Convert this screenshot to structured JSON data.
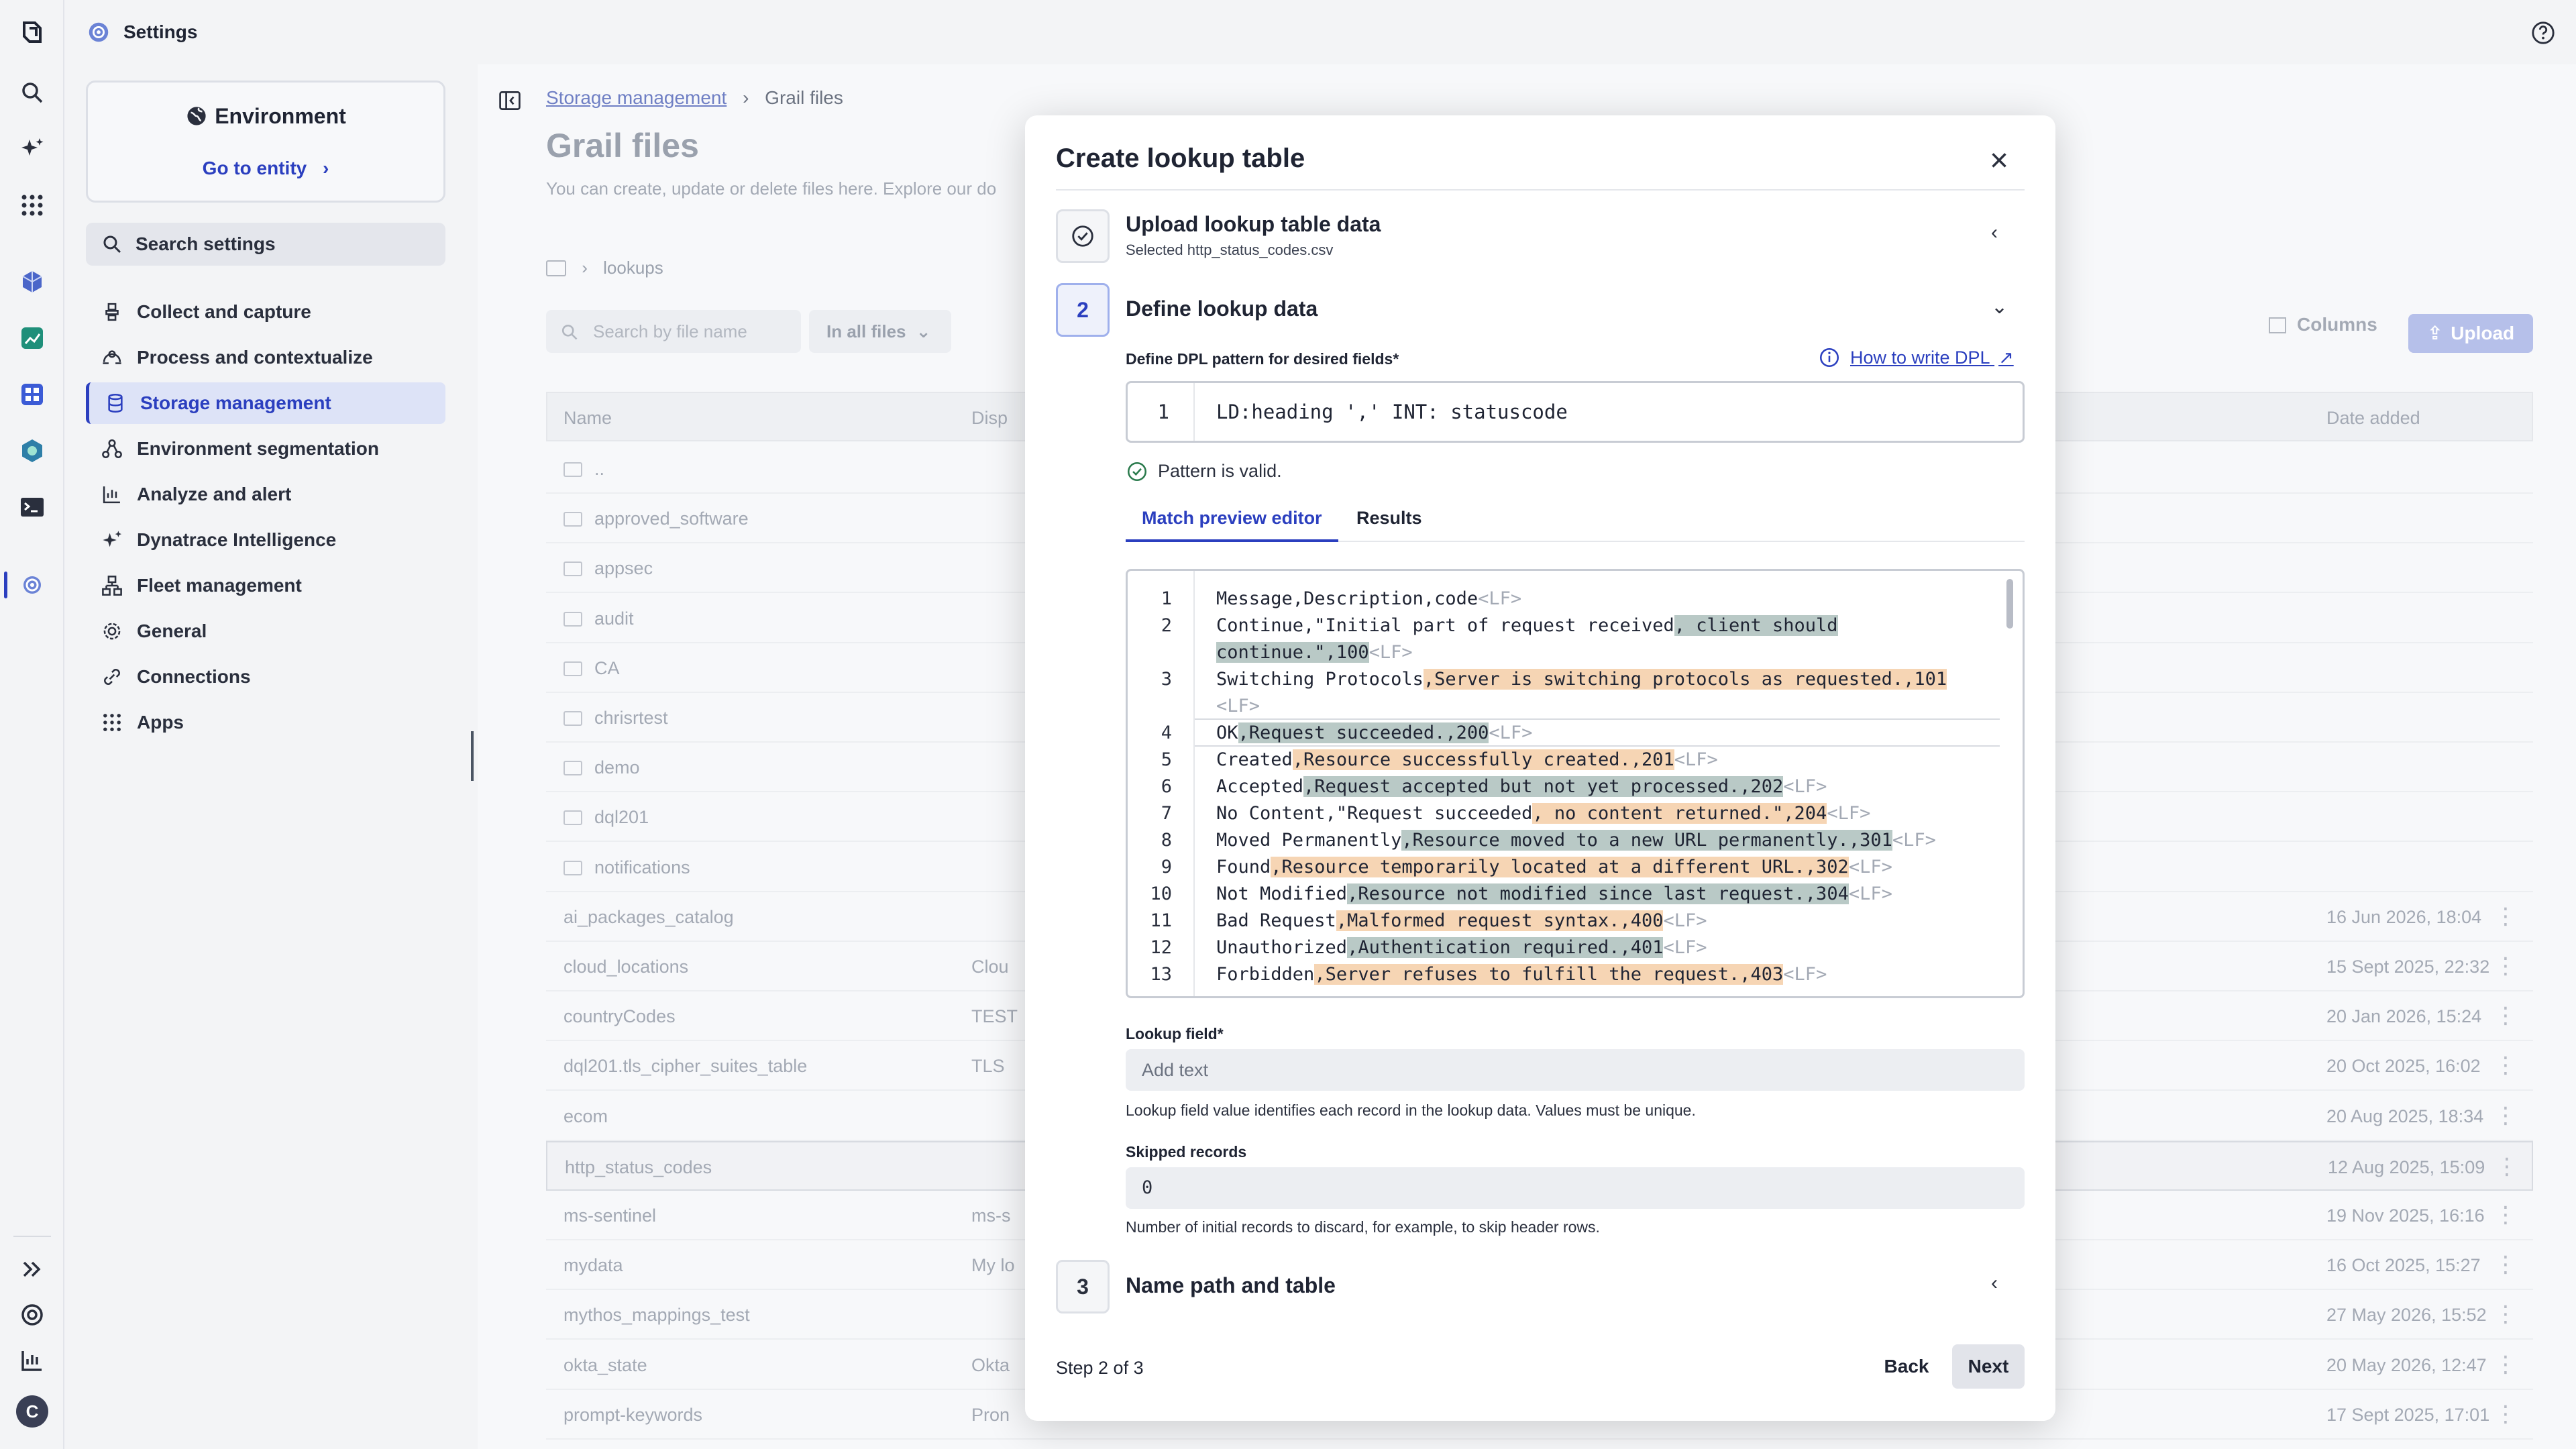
{
  "app": {
    "title": "Settings"
  },
  "sidebar": {
    "env_title": "Environment",
    "goto_label": "Go to entity",
    "search_label": "Search settings",
    "items": [
      {
        "label": "Collect and capture",
        "icon": "collect-icon"
      },
      {
        "label": "Process and contextualize",
        "icon": "process-icon"
      },
      {
        "label": "Storage management",
        "icon": "database-icon",
        "active": true
      },
      {
        "label": "Environment segmentation",
        "icon": "segmentation-icon"
      },
      {
        "label": "Analyze and alert",
        "icon": "analyze-icon"
      },
      {
        "label": "Dynatrace Intelligence",
        "icon": "sparkle-icon"
      },
      {
        "label": "Fleet management",
        "icon": "fleet-icon"
      },
      {
        "label": "General",
        "icon": "gear-icon"
      },
      {
        "label": "Connections",
        "icon": "connections-icon"
      },
      {
        "label": "Apps",
        "icon": "apps-grid-icon"
      }
    ]
  },
  "main": {
    "breadcrumb_parent": "Storage management",
    "breadcrumb_sep": "›",
    "breadcrumb_current": "Grail files",
    "title": "Grail files",
    "description": "You can create, update or delete files here. Explore our do",
    "folder": "lookups",
    "search_placeholder": "Search by file name",
    "scope": "In all files",
    "columns_label": "Columns",
    "upload_label": "Upload",
    "headers": {
      "name": "Name",
      "disp": "Disp",
      "date": "Date added"
    },
    "folders": [
      "..",
      "approved_software",
      "appsec",
      "audit",
      "CA",
      "chrisrtest",
      "demo",
      "dql201",
      "notifications"
    ],
    "files": [
      {
        "name": "ai_packages_catalog",
        "desc": "",
        "date": "16 Jun 2026, 18:04"
      },
      {
        "name": "cloud_locations",
        "desc": "Clou",
        "date": "15 Sept 2025, 22:32"
      },
      {
        "name": "countryCodes",
        "desc": "TEST",
        "date": "20 Jan 2026, 15:24"
      },
      {
        "name": "dql201.tls_cipher_suites_table",
        "desc": "TLS",
        "date": "20 Oct 2025, 16:02"
      },
      {
        "name": "ecom",
        "desc": "",
        "date": "20 Aug 2025, 18:34"
      },
      {
        "name": "http_status_codes",
        "desc": "",
        "date": "12 Aug 2025, 15:09"
      },
      {
        "name": "ms-sentinel",
        "desc": "ms-s",
        "date": "19 Nov 2025, 16:16"
      },
      {
        "name": "mydata",
        "desc": "My lo",
        "date": "16 Oct 2025, 15:27"
      },
      {
        "name": "mythos_mappings_test",
        "desc": "",
        "date": "27 May 2026, 15:52"
      },
      {
        "name": "okta_state",
        "desc": "Okta",
        "date": "20 May 2026, 12:47"
      },
      {
        "name": "prompt-keywords",
        "desc": "Pron",
        "date": "17 Sept 2025, 17:01"
      }
    ]
  },
  "modal": {
    "title": "Create lookup table",
    "step1": {
      "title": "Upload lookup table data",
      "subtitle": "Selected http_status_codes.csv"
    },
    "step2": {
      "number": "2",
      "title": "Define lookup data",
      "dpl_label": "Define DPL pattern for desired fields*",
      "howto_label": "How to write DPL",
      "dpl_line_no": "1",
      "dpl_code": "LD:heading ',' INT: statuscode",
      "valid_msg": "Pattern is valid.",
      "tab_preview": "Match preview editor",
      "tab_results": "Results",
      "lookup_label": "Lookup field*",
      "lookup_placeholder": "Add text",
      "lookup_help": "Lookup field value identifies each record in the lookup data. Values must be unique.",
      "skipped_label": "Skipped records",
      "skipped_value": "0",
      "skipped_help": "Number of initial records to discard, for example, to skip header rows."
    },
    "step3": {
      "number": "3",
      "title": "Name path and table"
    },
    "footer": {
      "step_count": "Step 2 of 3",
      "back_label": "Back",
      "next_label": "Next"
    },
    "lf_marker": "<LF>",
    "preview_lines": [
      {
        "n": "1",
        "segs": [
          [
            "Message,Description,code",
            ""
          ]
        ],
        "lf": true
      },
      {
        "n": "2",
        "segs": [
          [
            "Continue,\"Initial part of request received",
            ""
          ],
          [
            ", client should",
            "a"
          ]
        ],
        "lf": false
      },
      {
        "n": "",
        "segs": [
          [
            "continue.\",100",
            "a"
          ]
        ],
        "lf": true
      },
      {
        "n": "3",
        "segs": [
          [
            "Switching Protocols",
            ""
          ],
          [
            ",Server is switching protocols as requested.,101",
            "o"
          ]
        ],
        "lf": false
      },
      {
        "n": "",
        "segs": [],
        "lf": true
      },
      {
        "n": "4",
        "segs": [
          [
            "OK",
            ""
          ],
          [
            ",Request succeeded.,200",
            "a"
          ]
        ],
        "lf": true
      },
      {
        "n": "5",
        "segs": [
          [
            "Created",
            ""
          ],
          [
            ",Resource successfully created.,201",
            "o"
          ]
        ],
        "lf": true
      },
      {
        "n": "6",
        "segs": [
          [
            "Accepted",
            ""
          ],
          [
            ",Request accepted but not yet processed.,202",
            "a"
          ]
        ],
        "lf": true
      },
      {
        "n": "7",
        "segs": [
          [
            "No Content,\"Request succeeded",
            ""
          ],
          [
            ", no content returned.\",204",
            "o"
          ]
        ],
        "lf": true
      },
      {
        "n": "8",
        "segs": [
          [
            "Moved Permanently",
            ""
          ],
          [
            ",Resource moved to a new URL permanently.,301",
            "a"
          ]
        ],
        "lf": true
      },
      {
        "n": "9",
        "segs": [
          [
            "Found",
            ""
          ],
          [
            ",Resource temporarily located at a different URL.,302",
            "o"
          ]
        ],
        "lf": true
      },
      {
        "n": "10",
        "segs": [
          [
            "Not Modified",
            ""
          ],
          [
            ",Resource not modified since last request.,304",
            "a"
          ]
        ],
        "lf": true
      },
      {
        "n": "11",
        "segs": [
          [
            "Bad Request",
            ""
          ],
          [
            ",Malformed request syntax.,400",
            "o"
          ]
        ],
        "lf": true
      },
      {
        "n": "12",
        "segs": [
          [
            "Unauthorized",
            ""
          ],
          [
            ",Authentication required.,401",
            "a"
          ]
        ],
        "lf": true
      },
      {
        "n": "13",
        "segs": [
          [
            "Forbidden",
            ""
          ],
          [
            ",Server refuses to fulfill the request.,403",
            "o"
          ]
        ],
        "lf": true
      }
    ]
  },
  "rail": {
    "profile_initial": "C"
  },
  "colors": {
    "accent": "#2b3fbf",
    "match_a": "#b9c9c6",
    "match_b": "#f6d5b4"
  }
}
